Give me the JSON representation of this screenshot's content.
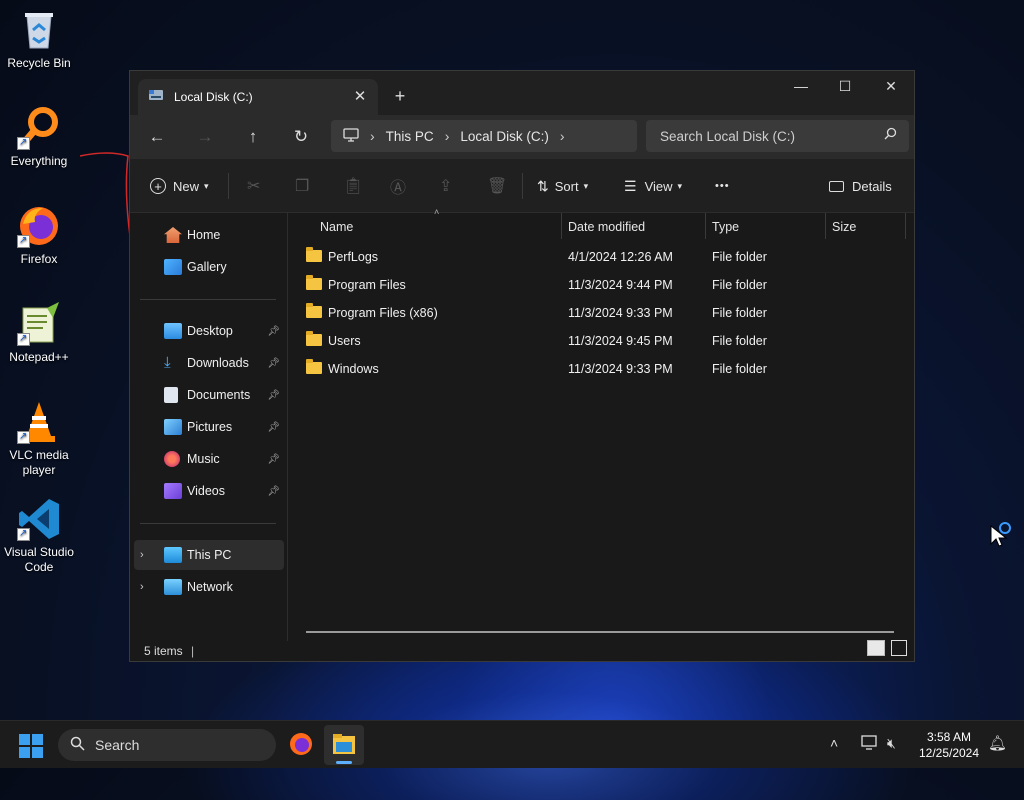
{
  "desktop": {
    "icons": [
      {
        "label": "Recycle Bin"
      },
      {
        "label": "Everything"
      },
      {
        "label": "Firefox"
      },
      {
        "label": "Notepad++"
      },
      {
        "label": "VLC media player"
      },
      {
        "label": "Visual Studio Code"
      }
    ]
  },
  "window": {
    "tab_title": "Local Disk (C:)",
    "tab_close": "✕",
    "new_tab": "+",
    "controls": {
      "minimize": "—",
      "maximize": "☐",
      "close": "✕"
    },
    "nav": {
      "back": "←",
      "forward": "→",
      "up": "↑",
      "refresh": "↻"
    },
    "address": {
      "segments": [
        "This PC",
        "Local Disk (C:)"
      ],
      "sep": "›"
    },
    "search_placeholder": "Search Local Disk (C:)",
    "toolbar": {
      "new_label": "New",
      "sort_label": "Sort",
      "view_label": "View",
      "more_label": "•••",
      "details_label": "Details"
    },
    "sidebar": {
      "home": "Home",
      "gallery": "Gallery",
      "quick": [
        {
          "label": "Desktop"
        },
        {
          "label": "Downloads"
        },
        {
          "label": "Documents"
        },
        {
          "label": "Pictures"
        },
        {
          "label": "Music"
        },
        {
          "label": "Videos"
        }
      ],
      "this_pc": "This PC",
      "network": "Network"
    },
    "columns": {
      "name": "Name",
      "date": "Date modified",
      "type": "Type",
      "size": "Size"
    },
    "files": [
      {
        "name": "PerfLogs",
        "date": "4/1/2024 12:26 AM",
        "type": "File folder"
      },
      {
        "name": "Program Files",
        "date": "11/3/2024 9:44 PM",
        "type": "File folder"
      },
      {
        "name": "Program Files (x86)",
        "date": "11/3/2024 9:33 PM",
        "type": "File folder"
      },
      {
        "name": "Users",
        "date": "11/3/2024 9:45 PM",
        "type": "File folder"
      },
      {
        "name": "Windows",
        "date": "11/3/2024 9:33 PM",
        "type": "File folder"
      }
    ],
    "status": "5 items"
  },
  "taskbar": {
    "search_label": "Search",
    "time": "3:58 AM",
    "date": "12/25/2024"
  },
  "colors": {
    "accent": "#0078d4",
    "folder": "#f5c542"
  }
}
